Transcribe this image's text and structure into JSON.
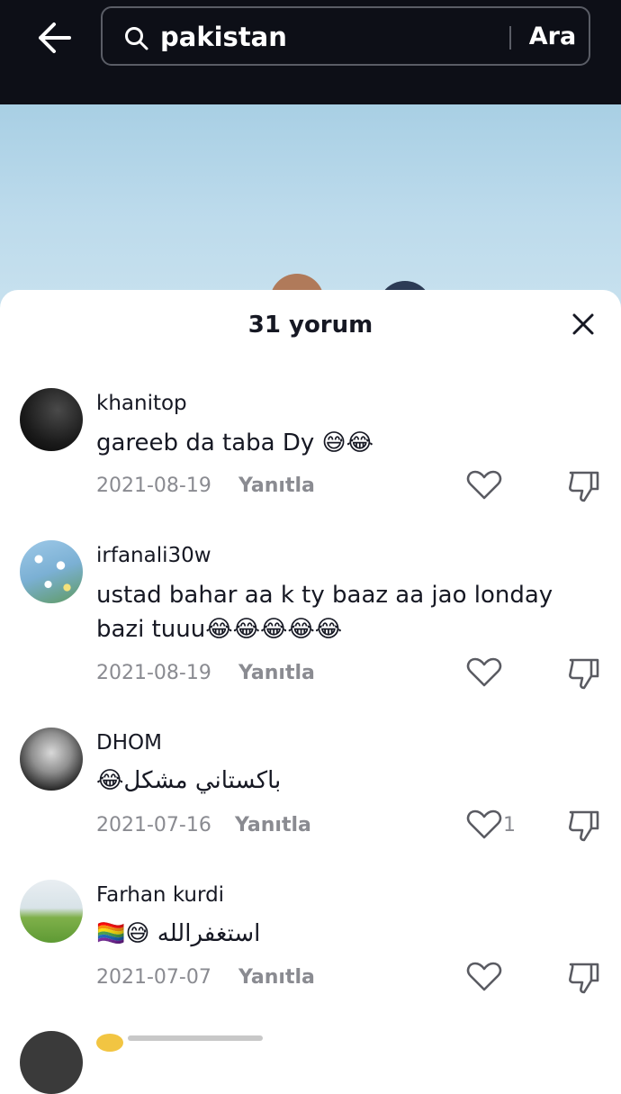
{
  "search": {
    "query": "pakistan",
    "button_label": "Ara"
  },
  "comments_sheet": {
    "title": "31 yorum",
    "reply_label": "Yanıtla",
    "comments": [
      {
        "username": "khanitop",
        "text": "gareeb da taba Dy 😅😂",
        "date": "2021-08-19",
        "likes": ""
      },
      {
        "username": "irfanali30w",
        "text": "ustad bahar aa k ty baaz aa jao londay bazi tuuu😂😂😂😂😂",
        "date": "2021-08-19",
        "likes": ""
      },
      {
        "username": "DHOM",
        "text": "😂باكستاني مشكل",
        "date": "2021-07-16",
        "likes": "1"
      },
      {
        "username": "Farhan kurdi",
        "text": "🏳️‍🌈😅 استغفرالله",
        "date": "2021-07-07",
        "likes": ""
      }
    ]
  },
  "icons": {
    "back": "arrow-left-icon",
    "search": "search-icon",
    "close": "close-icon",
    "like": "heart-icon",
    "dislike": "thumbs-down-icon"
  },
  "colors": {
    "topbar_bg": "#0d0f17",
    "text_primary": "#161823",
    "text_secondary": "#8a8b91"
  }
}
